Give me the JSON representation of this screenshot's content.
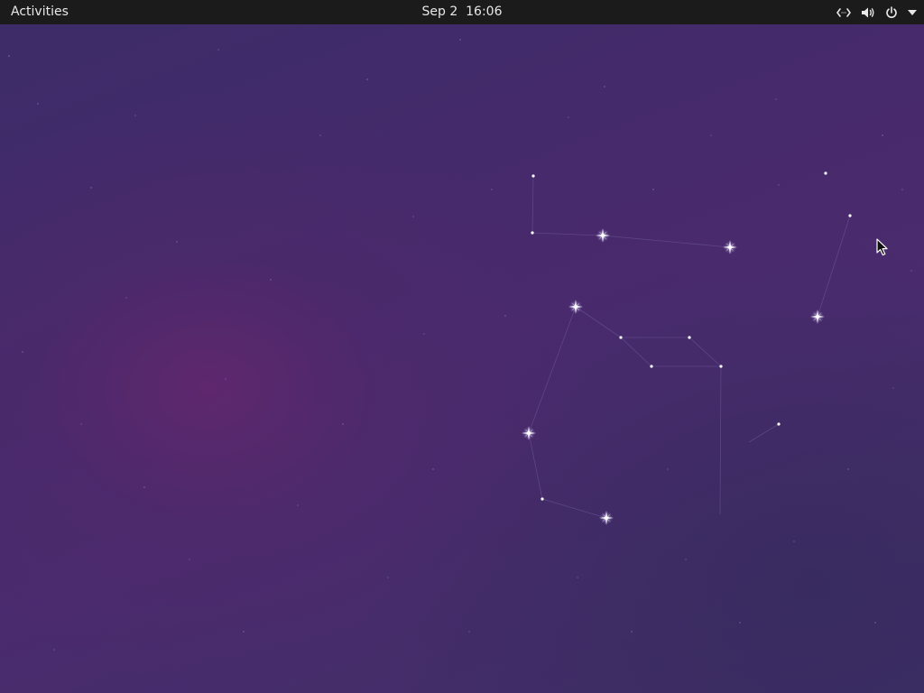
{
  "topbar": {
    "activities_label": "Activities",
    "clock": "Sep 2  16:06",
    "status_icons": [
      "network-wired-icon",
      "volume-icon",
      "power-icon",
      "dropdown-arrow-icon"
    ]
  },
  "desktop": {
    "wallpaper": "purple-night-sky-constellation",
    "colors": {
      "topbar_bg": "#1b1b1b",
      "topbar_text": "#e8e8e8",
      "sky_base": "#472a6c",
      "sky_glow": "#66266e",
      "star": "#ffffff"
    }
  },
  "pointer": {
    "icon": "mouse-pointer-icon"
  }
}
